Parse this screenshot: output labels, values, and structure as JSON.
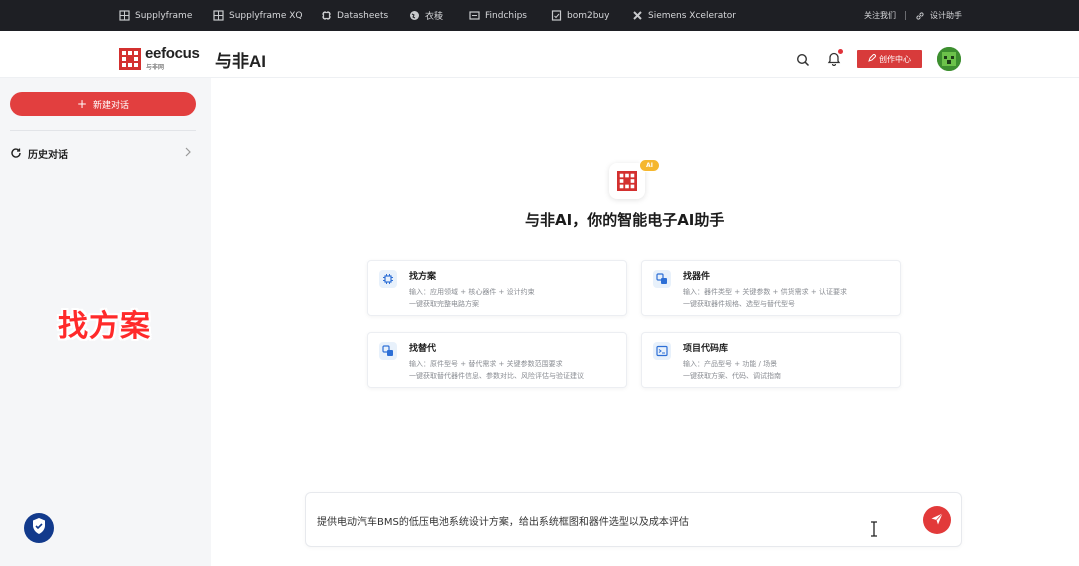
{
  "topbar": {
    "items": [
      {
        "label": "Supplyframe",
        "icon": "supplyframe-icon"
      },
      {
        "label": "Supplyframe XQ",
        "icon": "supplyframe-xq-icon"
      },
      {
        "label": "Datasheets",
        "icon": "datasheets-icon"
      },
      {
        "label": "衣稜",
        "icon": "globe-icon"
      },
      {
        "label": "Findchips",
        "icon": "findchips-icon"
      },
      {
        "label": "bom2buy",
        "icon": "bom2buy-icon"
      },
      {
        "label": "Siemens Xcelerator",
        "icon": "siemens-icon"
      }
    ],
    "about": "关注我们",
    "design_assistant": "设计助手"
  },
  "header": {
    "logo_text": "eefocus",
    "logo_sub": "与非网",
    "app_title": "与非AI",
    "create_label": "创作中心"
  },
  "sidebar": {
    "new_chat_label": "新建对话",
    "history_label": "历史对话"
  },
  "overlay": {
    "text": "找方案"
  },
  "hero": {
    "badge": "AI",
    "title": "与非AI，你的智能电子AI助手"
  },
  "cards": [
    {
      "title": "找方案",
      "line1": "输入：应用领域 + 核心器件 + 设计约束",
      "line2": "一键获取完整电路方案",
      "icon": "chip-icon"
    },
    {
      "title": "找器件",
      "line1": "输入：器件类型 + 关键参数 + 供货需求 + 认证要求",
      "line2": "一键获取器件规格、选型与替代型号",
      "icon": "component-icon"
    },
    {
      "title": "找替代",
      "line1": "输入：原件型号 + 替代需求 + 关键参数范围要求",
      "line2": "一键获取替代器件信息、参数对比、风险评估与验证建议",
      "icon": "replace-icon"
    },
    {
      "title": "项目代码库",
      "line1": "输入：产品型号 + 功能 / 场景",
      "line2": "一键获取方案、代码、调试指南",
      "icon": "terminal-icon"
    }
  ],
  "input": {
    "value": "提供电动汽车BMS的低压电池系统设计方案，给出系统框图和器件选型以及成本评估"
  },
  "colors": {
    "accent": "#e23f3f",
    "topbar_bg": "#1e1f24",
    "sidebar_bg": "#f5f6f8",
    "overlay_red": "#ff2a2a",
    "shield_blue": "#123a8c"
  }
}
